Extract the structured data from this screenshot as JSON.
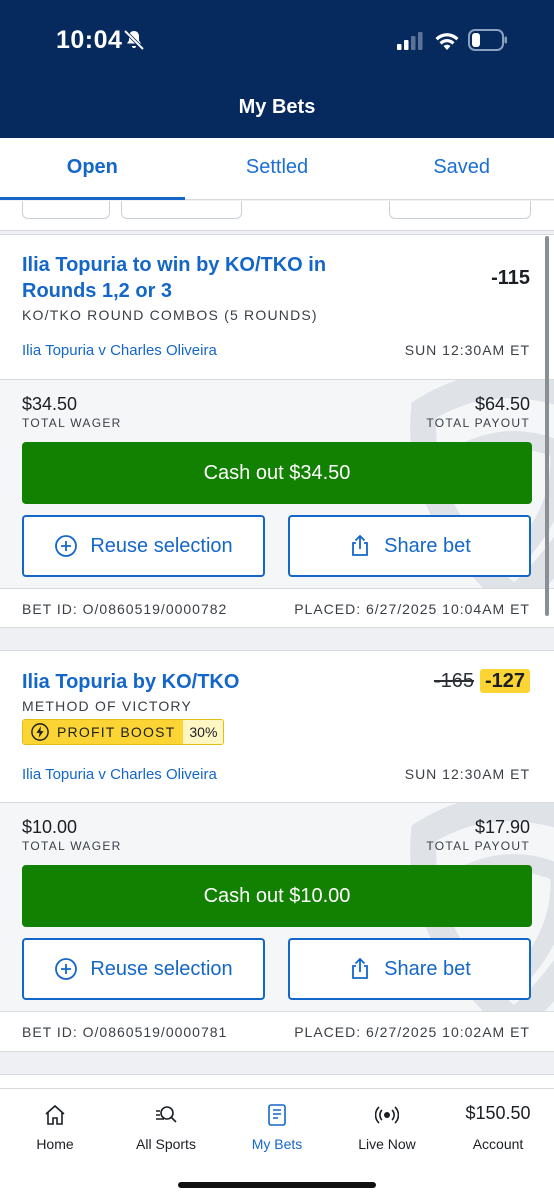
{
  "status_bar": {
    "time": "10:04"
  },
  "header": {
    "title": "My Bets"
  },
  "tabs": [
    {
      "label": "Open",
      "active": true
    },
    {
      "label": "Settled",
      "active": false
    },
    {
      "label": "Saved",
      "active": false
    }
  ],
  "bets": [
    {
      "selection": "Ilia Topuria to win by KO/TKO in Rounds 1,2 or 3",
      "market": "KO/TKO ROUND COMBOS (5 ROUNDS)",
      "odds": "-115",
      "event": "Ilia Topuria v Charles Oliveira",
      "event_time": "SUN 12:30AM ET",
      "total_wager": "$34.50",
      "total_wager_label": "TOTAL WAGER",
      "total_payout": "$64.50",
      "total_payout_label": "TOTAL PAYOUT",
      "cashout_label": "Cash out $34.50",
      "reuse_label": "Reuse selection",
      "share_label": "Share bet",
      "bet_id": "BET ID: O/0860519/0000782",
      "placed": "PLACED: 6/27/2025 10:04AM ET"
    },
    {
      "selection": "Ilia Topuria by KO/TKO",
      "market": "METHOD OF VICTORY",
      "odds_old": "-165",
      "odds": "-127",
      "boost_label": "PROFIT BOOST",
      "boost_pct": "30%",
      "event": "Ilia Topuria v Charles Oliveira",
      "event_time": "SUN 12:30AM ET",
      "total_wager": "$10.00",
      "total_wager_label": "TOTAL WAGER",
      "total_payout": "$17.90",
      "total_payout_label": "TOTAL PAYOUT",
      "cashout_label": "Cash out $10.00",
      "reuse_label": "Reuse selection",
      "share_label": "Share bet",
      "bet_id": "BET ID: O/0860519/0000781",
      "placed": "PLACED: 6/27/2025 10:02AM ET"
    }
  ],
  "bottom_nav": [
    {
      "label": "Home",
      "icon": "home-icon"
    },
    {
      "label": "All Sports",
      "icon": "search-icon"
    },
    {
      "label": "My Bets",
      "icon": "betslip-icon",
      "active": true
    },
    {
      "label": "Live Now",
      "icon": "live-icon"
    },
    {
      "label": "Account",
      "balance": "$150.50"
    }
  ],
  "colors": {
    "header_bg": "#062a5e",
    "accent": "#1467c9",
    "cashout": "#128000",
    "boost": "#fcd535"
  }
}
